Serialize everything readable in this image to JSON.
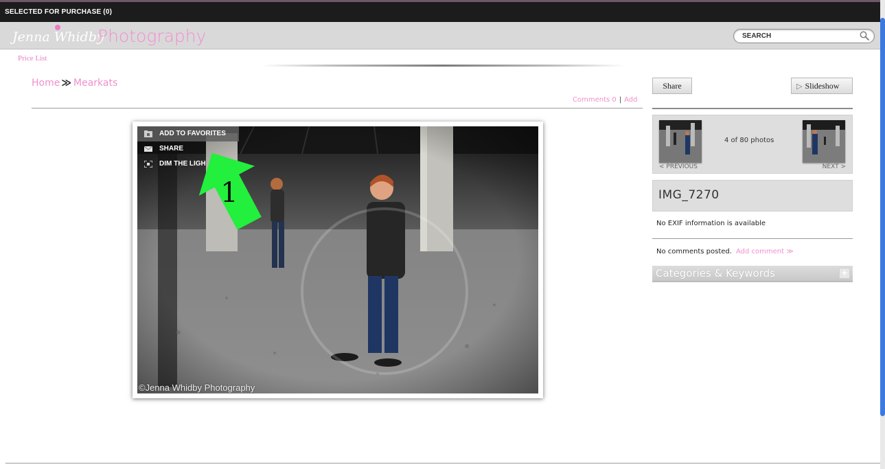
{
  "purchase_bar": {
    "label": "SELECTED FOR PURCHASE (0)"
  },
  "header": {
    "logo_script": "Jenna Whidby",
    "logo_word": "Photography",
    "search": {
      "placeholder": "SEARCH",
      "value": ""
    }
  },
  "nav": {
    "price_list": "Price List"
  },
  "breadcrumb": {
    "home": "Home",
    "separator": "≫",
    "current": "Mearkats"
  },
  "comments_bar": {
    "comments": "Comments 0",
    "divider": "|",
    "add": "Add"
  },
  "photo": {
    "menu": [
      {
        "label": "ADD TO FAVORITES",
        "icon": "folder-favorite-icon"
      },
      {
        "label": "SHARE",
        "icon": "envelope-icon"
      },
      {
        "label": "DIM THE LIGH",
        "icon": "dim-lights-icon"
      }
    ],
    "copyright": "©Jenna Whidby Photography",
    "annotation_number": "1"
  },
  "sidebar": {
    "share": "Share",
    "slideshow": "Slideshow",
    "photo_count": "4 of 80 photos",
    "previous": "PREVIOUS",
    "next": "NEXT",
    "image_title": "IMG_7270",
    "exif": "No EXIF information is available",
    "no_comments": "No comments posted.",
    "add_comment": "Add comment",
    "categories": "Categories & Keywords",
    "categories_toggle": "+"
  },
  "colors": {
    "accent_pink": "#f08fcc",
    "header_gray": "#d9d9d9",
    "topbar": "#1c1c1c",
    "annotation_green": "#22f03c"
  }
}
